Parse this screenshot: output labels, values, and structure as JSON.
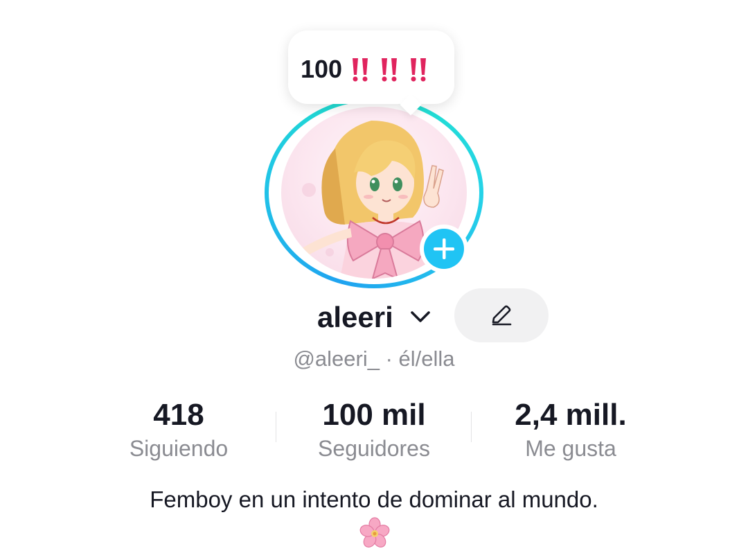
{
  "bubble": {
    "text": "100",
    "emoji_icons": [
      "double-exclamation-icon",
      "double-exclamation-icon",
      "double-exclamation-icon"
    ],
    "emoji_color": "#e0245e"
  },
  "avatar": {
    "ring_colors": [
      "#20e3c8",
      "#1fa3f0"
    ],
    "add_icon": "plus-icon",
    "add_color": "#20c4f4"
  },
  "profile": {
    "display_name": "aleeri",
    "dropdown_icon": "chevron-down-icon",
    "edit_icon": "pencil-icon",
    "handle_line": "@aleeri_ · él/ella"
  },
  "stats": [
    {
      "value": "418",
      "label": "Siguiendo"
    },
    {
      "value": "100 mil",
      "label": "Seguidores"
    },
    {
      "value": "2,4 mill.",
      "label": "Me gusta"
    }
  ],
  "bio": {
    "text": "Femboy en un intento de dominar al mundo.",
    "emoji_icon": "cherry-blossom-icon"
  }
}
